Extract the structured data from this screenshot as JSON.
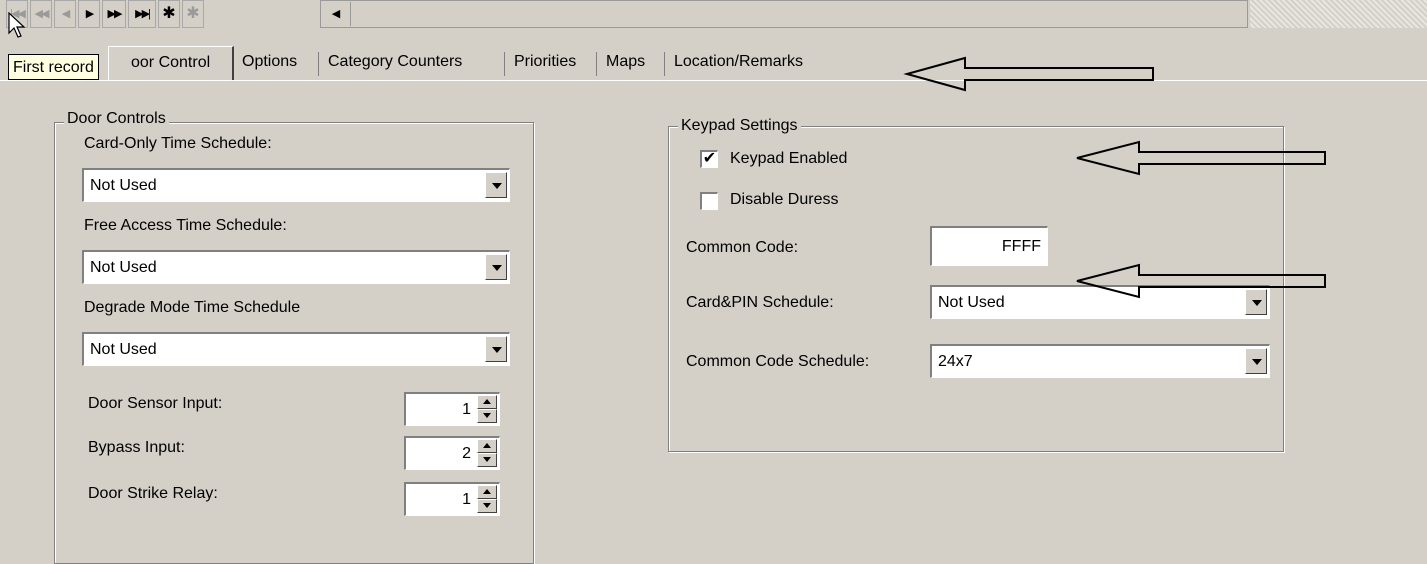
{
  "toolbar": {
    "nav_icons": [
      "first-record-icon",
      "previous-page-icon",
      "previous-record-icon",
      "next-record-icon",
      "next-page-icon",
      "last-record-icon",
      "new-record-icon",
      "delete-record-icon"
    ],
    "nav_glyphs": [
      "|◀◀",
      "◀◀",
      "◀",
      "▶",
      "▶▶",
      "▶▶|",
      "✱",
      "✱"
    ],
    "scroll_left_glyph": "◀"
  },
  "tooltip": {
    "text": "First record"
  },
  "tabs": [
    {
      "label": "Door Control",
      "visible_fragment": "oor Control"
    },
    {
      "label": "Options"
    },
    {
      "label": "Category Counters"
    },
    {
      "label": "Priorities"
    },
    {
      "label": "Maps"
    },
    {
      "label": "Location/Remarks"
    }
  ],
  "door_controls": {
    "title": "Door Controls",
    "card_only_label": "Card-Only Time Schedule:",
    "card_only_value": "Not Used",
    "free_access_label": "Free Access Time Schedule:",
    "free_access_value": "Not Used",
    "degrade_label": "Degrade Mode Time Schedule",
    "degrade_value": "Not Used",
    "sensor_label": "Door Sensor Input:",
    "sensor_value": "1",
    "bypass_label": "Bypass Input:",
    "bypass_value": "2",
    "strike_label": "Door Strike Relay:",
    "strike_value": "1"
  },
  "keypad": {
    "title": "Keypad Settings",
    "enabled_label": "Keypad Enabled",
    "enabled_checked": true,
    "enabled_mark": "✔",
    "duress_label": "Disable Duress",
    "duress_checked": false,
    "common_code_label": "Common Code:",
    "common_code_value": "FFFF",
    "card_pin_label": "Card&PIN Schedule:",
    "card_pin_value": "Not Used",
    "common_sched_label": "Common Code Schedule:",
    "common_sched_value": "24x7"
  },
  "annotations": {
    "arrow_color": "#000000",
    "arrow_icons": [
      "annotation-arrow-icon",
      "annotation-arrow-icon",
      "annotation-arrow-icon"
    ]
  }
}
